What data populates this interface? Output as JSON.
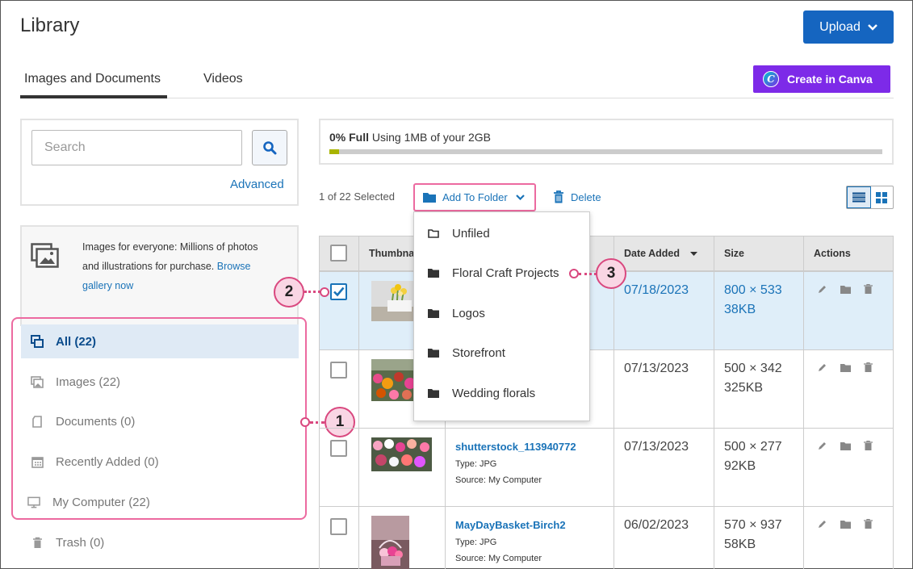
{
  "header": {
    "title": "Library",
    "upload_label": "Upload"
  },
  "tabs": [
    {
      "label": "Images and Documents",
      "active": true
    },
    {
      "label": "Videos",
      "active": false
    }
  ],
  "canva": {
    "label": "Create in Canva",
    "logo_letter": "C",
    "color": "#7d2ae8"
  },
  "search": {
    "placeholder": "Search",
    "advanced_label": "Advanced"
  },
  "promo": {
    "text": "Images for everyone: Millions of photos and illustrations for purchase.",
    "link": "Browse gallery now"
  },
  "sidebar": {
    "items": [
      {
        "label": "All (22)",
        "icon": "all-icon",
        "active": true
      },
      {
        "label": "Images (22)",
        "icon": "images-icon"
      },
      {
        "label": "Documents (0)",
        "icon": "document-icon"
      },
      {
        "label": "Recently Added (0)",
        "icon": "calendar-icon"
      },
      {
        "label": "My Computer (22)",
        "icon": "computer-icon"
      },
      {
        "label": "Trash (0)",
        "icon": "trash-icon"
      }
    ]
  },
  "storage": {
    "percent_label": "0% Full",
    "usage": "Using 1MB of your 2GB",
    "fill_fraction": 0.005
  },
  "toolbar": {
    "selection": "1 of 22 Selected",
    "add_to_folder": "Add To Folder",
    "delete": "Delete"
  },
  "table": {
    "columns": [
      "Thumbnail",
      "Date Added",
      "Size",
      "Actions"
    ],
    "rows": [
      {
        "name": "",
        "type": "",
        "source": "",
        "date": "07/18/2023",
        "dims": "800 × 533",
        "filesize": "38KB",
        "selected": true
      },
      {
        "name": "",
        "type": "",
        "source": "",
        "date": "07/13/2023",
        "dims": "500 × 342",
        "filesize": "325KB",
        "selected": false
      },
      {
        "name": "shutterstock_113940772",
        "type": "Type: JPG",
        "source": "Source: My Computer",
        "date": "07/13/2023",
        "dims": "500 × 277",
        "filesize": "92KB",
        "selected": false
      },
      {
        "name": "MayDayBasket-Birch2",
        "type": "Type: JPG",
        "source": "Source: My Computer",
        "date": "06/02/2023",
        "dims": "570 × 937",
        "filesize": "58KB",
        "selected": false
      }
    ]
  },
  "folder_menu": {
    "items": [
      {
        "label": "Unfiled",
        "icon": "folder-outline-icon"
      },
      {
        "label": "Floral Craft Projects",
        "icon": "folder-icon"
      },
      {
        "label": "Logos",
        "icon": "folder-icon"
      },
      {
        "label": "Storefront",
        "icon": "folder-icon"
      },
      {
        "label": "Wedding florals",
        "icon": "folder-icon"
      }
    ]
  },
  "callouts": [
    "1",
    "2",
    "3"
  ],
  "colors": {
    "accent": "#1565c0",
    "link": "#1a73b8",
    "callout": "#d9487f",
    "selected_row": "#dfeef9"
  }
}
